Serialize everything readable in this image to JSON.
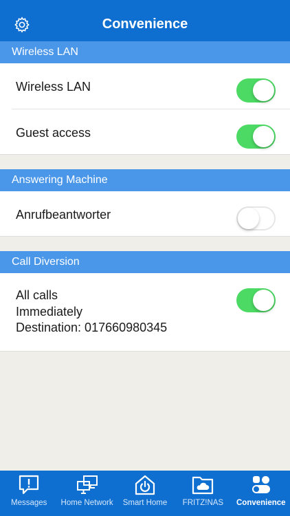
{
  "header": {
    "title": "Convenience",
    "settings_icon": "gear-icon"
  },
  "sections": {
    "wlan": {
      "title": "Wireless LAN",
      "rows": [
        {
          "label": "Wireless LAN",
          "toggle_on": true
        },
        {
          "label": "Guest access",
          "toggle_on": true
        }
      ]
    },
    "answering": {
      "title": "Answering Machine",
      "rows": [
        {
          "label": "Anrufbeantworter",
          "toggle_on": false
        }
      ]
    },
    "diversion": {
      "title": "Call Diversion",
      "rows": [
        {
          "line1": "All calls",
          "line2": "Immediately",
          "line3": "Destination: 017660980345",
          "toggle_on": true
        }
      ]
    }
  },
  "tabbar": {
    "tabs": [
      {
        "label": "Messages",
        "icon": "message-alert-icon",
        "active": false
      },
      {
        "label": "Home Network",
        "icon": "network-monitors-icon",
        "active": false
      },
      {
        "label": "Smart Home",
        "icon": "smart-home-power-icon",
        "active": false
      },
      {
        "label": "FRITZ!NAS",
        "icon": "folder-cloud-icon",
        "active": false
      },
      {
        "label": "Convenience",
        "icon": "convenience-icon",
        "active": true
      }
    ]
  },
  "colors": {
    "header_bg": "#0f6fd0",
    "section_bg": "#4a97ea",
    "toggle_on": "#4cd964",
    "page_bg": "#efeee9"
  }
}
